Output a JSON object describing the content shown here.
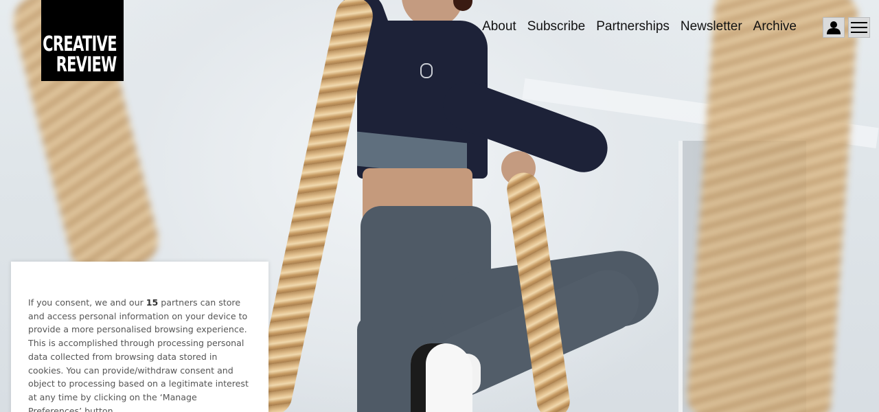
{
  "brand": {
    "logo_line1": "CREATIVE",
    "logo_line2": "REVIEW"
  },
  "nav": {
    "items": [
      {
        "label": "About"
      },
      {
        "label": "Subscribe"
      },
      {
        "label": "Partnerships"
      },
      {
        "label": "Newsletter"
      },
      {
        "label": "Archive"
      }
    ]
  },
  "header_icons": {
    "account": "user-icon",
    "menu": "hamburger-menu-icon"
  },
  "consent": {
    "text_before_count": "If you consent, we and our ",
    "partner_count": "15",
    "text_after_count": " partners can store and access personal information on your device to provide a more personalised browsing experience. This is accomplished through processing personal data collected from browsing data stored in cookies. You can provide/withdraw consent and object to processing based on a legitimate interest at any time by clicking on the ‘Manage Preferences’ button."
  },
  "colors": {
    "logo_background": "#000000",
    "nav_text": "#111111",
    "consent_text": "#555555"
  }
}
